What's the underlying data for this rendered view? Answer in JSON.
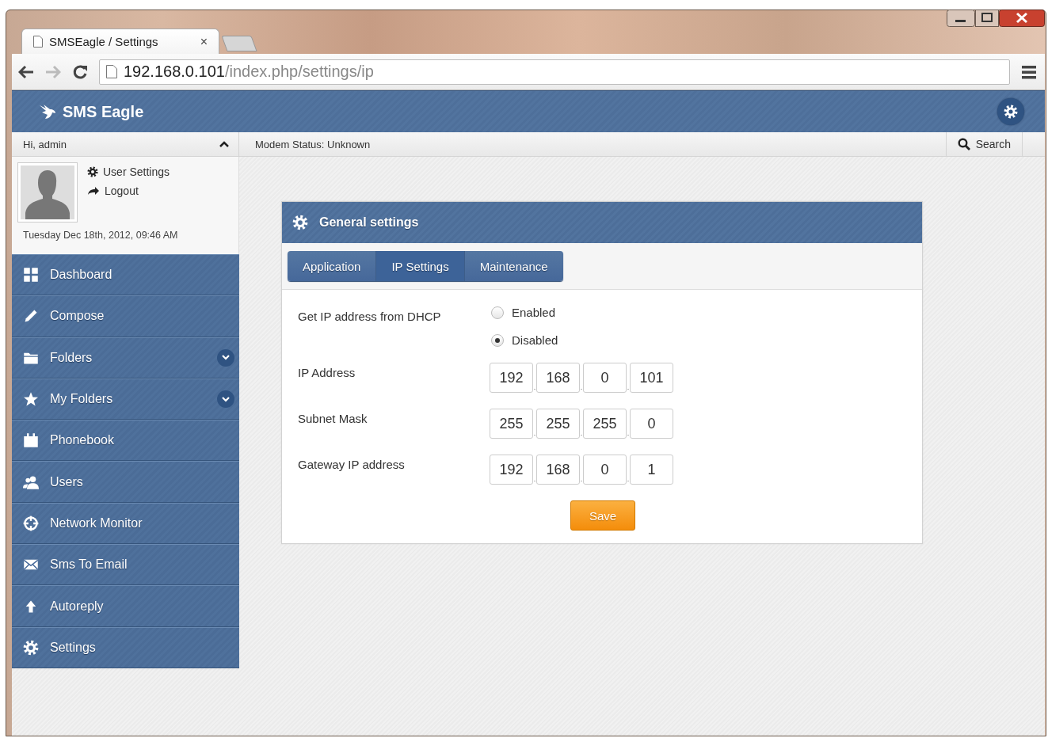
{
  "browser": {
    "tab_title": "SMSEagle / Settings",
    "tab_close": "×",
    "url_host": "192.168.0.101",
    "url_path": "/index.php/settings/ip"
  },
  "app": {
    "logo": "SMS Eagle"
  },
  "user_bar": {
    "greeting": "Hi, admin",
    "modem_status": "Modem Status: Unknown",
    "search": "Search"
  },
  "user_panel": {
    "links": [
      {
        "kind": "settings",
        "label": "User Settings"
      },
      {
        "kind": "logout",
        "label": "Logout"
      }
    ],
    "date": "Tuesday Dec 18th, 2012, 09:46 AM"
  },
  "sidebar": {
    "items": [
      {
        "kind": "dashboard",
        "label": "Dashboard",
        "expandable": false
      },
      {
        "kind": "compose",
        "label": "Compose",
        "expandable": false
      },
      {
        "kind": "folder",
        "label": "Folders",
        "expandable": true
      },
      {
        "kind": "star",
        "label": "My Folders",
        "expandable": true
      },
      {
        "kind": "calendar",
        "label": "Phonebook",
        "expandable": false
      },
      {
        "kind": "users",
        "label": "Users",
        "expandable": false
      },
      {
        "kind": "network",
        "label": "Network Monitor",
        "expandable": false
      },
      {
        "kind": "mail",
        "label": "Sms To Email",
        "expandable": false
      },
      {
        "kind": "upload",
        "label": "Autoreply",
        "expandable": false
      },
      {
        "kind": "settings",
        "label": "Settings",
        "expandable": false
      }
    ]
  },
  "panel": {
    "title": "General settings",
    "tabs": [
      {
        "label": "Application",
        "selected": false
      },
      {
        "label": "IP Settings",
        "selected": true
      },
      {
        "label": "Maintenance",
        "selected": false
      }
    ],
    "dhcp": {
      "label": "Get IP address from DHCP",
      "options": [
        {
          "label": "Enabled",
          "selected": false
        },
        {
          "label": "Disabled",
          "selected": true
        }
      ]
    },
    "ip_fields": [
      {
        "label": "IP Address",
        "octets": [
          "192",
          "168",
          "0",
          "101"
        ],
        "separators": [
          ".",
          ".",
          "."
        ]
      },
      {
        "label": "Subnet Mask",
        "octets": [
          "255",
          "255",
          "255",
          "0"
        ],
        "separators": [
          ".",
          ".",
          "."
        ]
      },
      {
        "label": "Gateway IP address",
        "octets": [
          "192",
          "168",
          "0",
          "1"
        ],
        "separators": [
          ".",
          ".",
          "."
        ]
      }
    ],
    "save": "Save"
  }
}
